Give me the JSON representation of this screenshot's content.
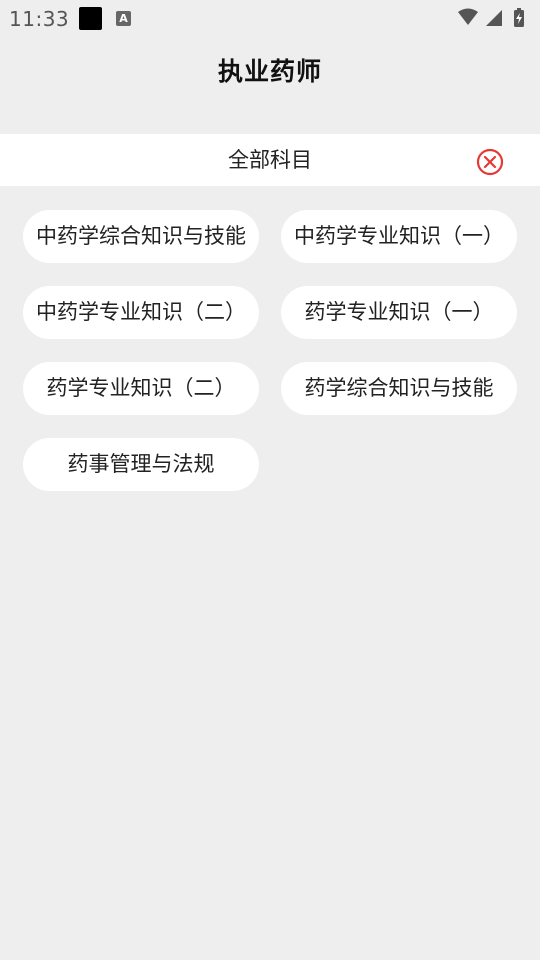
{
  "status_bar": {
    "time": "11:33",
    "notification_icons": [
      "black-square-icon",
      "text-a-icon"
    ],
    "indicator_icons": [
      "wifi-icon",
      "signal-icon",
      "battery-icon"
    ]
  },
  "header": {
    "title": "执业药师"
  },
  "filter": {
    "label": "全部科目",
    "close_icon": "close-circle-icon",
    "close_color": "#e53935"
  },
  "subjects": [
    {
      "label": "中药学综合知识与技能"
    },
    {
      "label": "中药学专业知识（一）"
    },
    {
      "label": "中药学专业知识（二）"
    },
    {
      "label": "药学专业知识（一）"
    },
    {
      "label": "药学专业知识（二）"
    },
    {
      "label": "药学综合知识与技能"
    },
    {
      "label": "药事管理与法规"
    }
  ],
  "colors": {
    "background": "#eeeeee",
    "chip_background": "#ffffff",
    "accent": "#e53935"
  }
}
